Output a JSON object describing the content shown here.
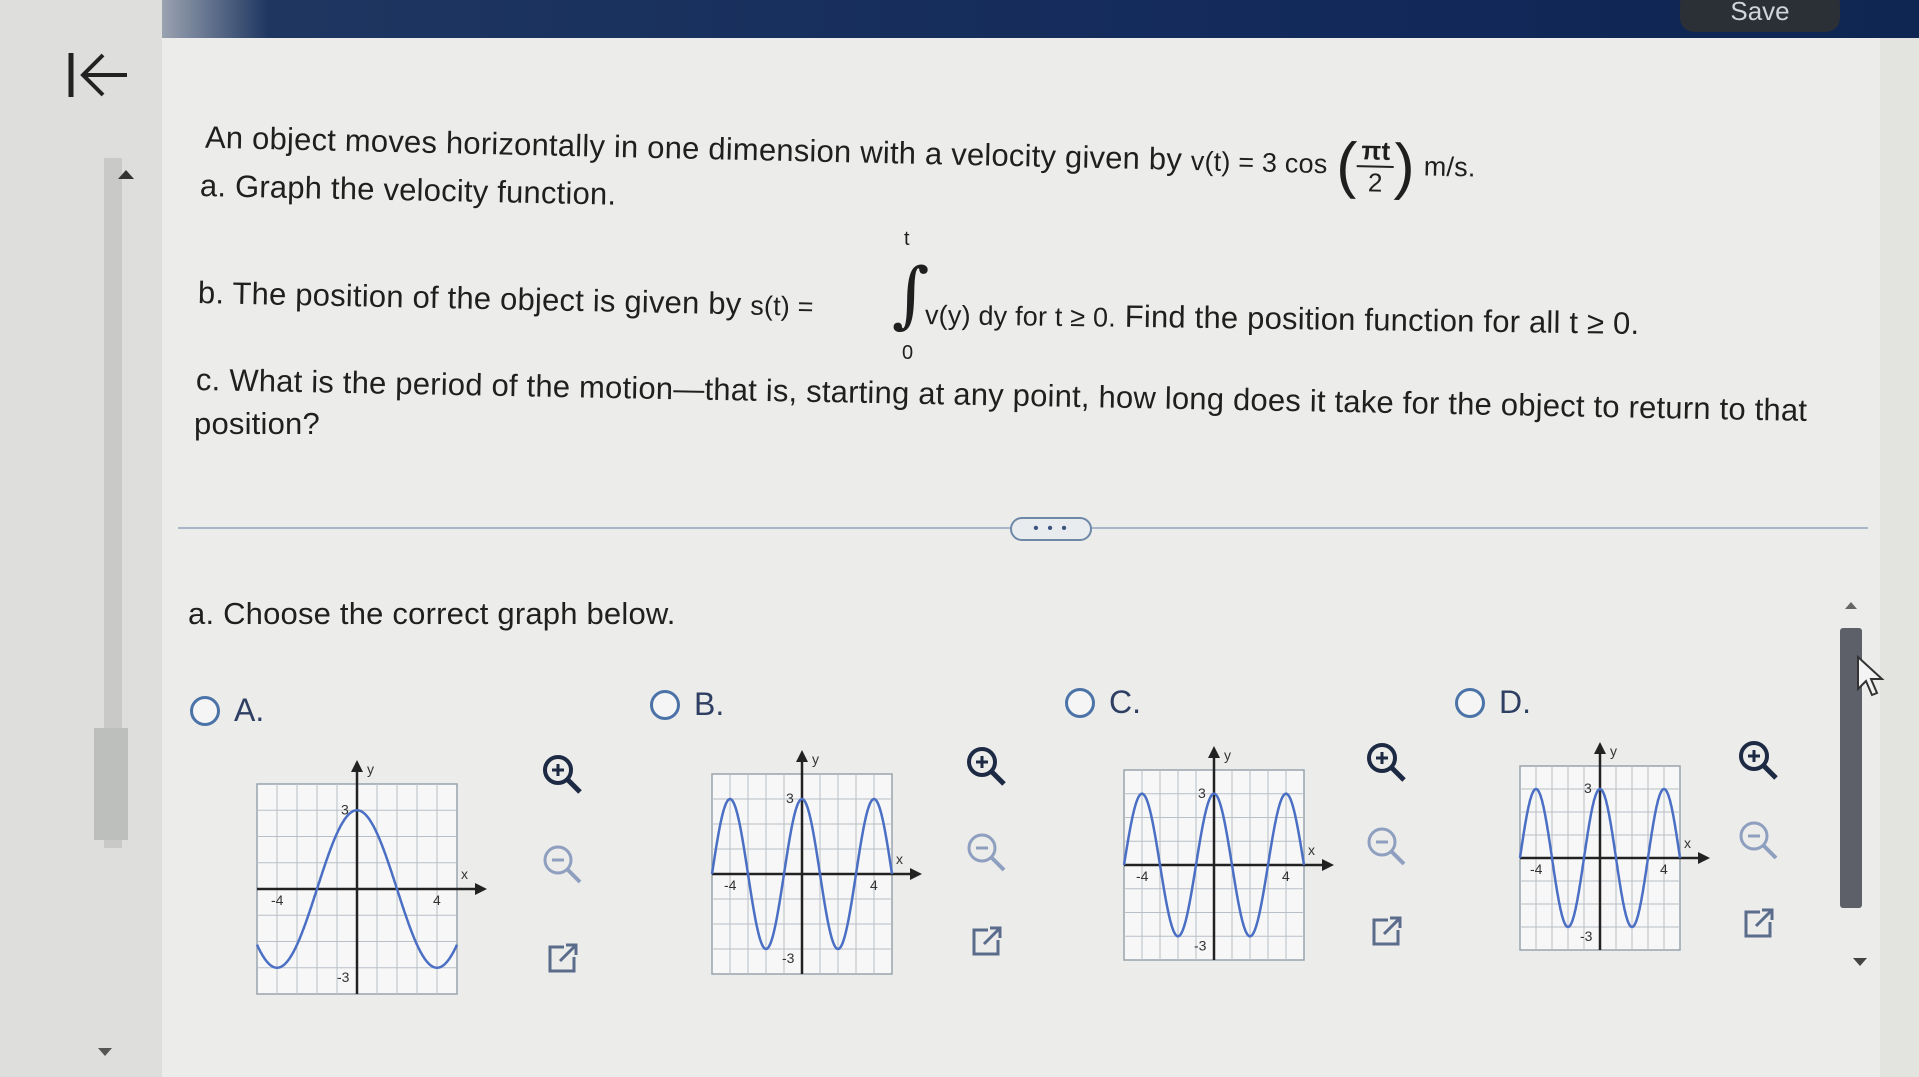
{
  "toolbar": {
    "save_label": "Save"
  },
  "question": {
    "intro_before": "An object moves horizontally in one dimension with a velocity given by",
    "velocity_lhs": "v(t) = 3 cos",
    "velocity_num": "πt",
    "velocity_den": "2",
    "velocity_units": "m/s.",
    "part_a": "a. Graph the velocity function.",
    "part_b_before": "b. The position of the object is given by",
    "integral_lhs": "s(t) =",
    "integral_upper": "t",
    "integral_lower": "0",
    "integral_body": "v(y) dy for t ≥ 0.",
    "part_b_after": "Find the position function for all t ≥ 0.",
    "part_c_line1": "c. What is the period of the motion—that is, starting at any point, how long does it take for the object to return to that",
    "part_c_line2": "position?"
  },
  "divider_label": "• • •",
  "answer": {
    "prompt": "a. Choose the correct graph below.",
    "options": [
      {
        "label": "A.",
        "ytop": "3",
        "ybot": "-3",
        "xl": "-4",
        "xr": "4",
        "yaxis": "y",
        "xaxis": "x"
      },
      {
        "label": "B.",
        "ytop": "3",
        "ybot": "-3",
        "xl": "-4",
        "xr": "4",
        "yaxis": "y",
        "xaxis": "x"
      },
      {
        "label": "C.",
        "ytop": "3",
        "ybot": "-3",
        "xl": "-4",
        "xr": "4",
        "yaxis": "y",
        "xaxis": "x"
      },
      {
        "label": "D.",
        "ytop": "3",
        "ybot": "-3",
        "xl": "-4",
        "xr": "4",
        "yaxis": "y",
        "xaxis": "x"
      }
    ]
  },
  "icons": {
    "back": "first-page-arrow-icon",
    "zoom_in": "zoom-in-icon",
    "zoom_out": "zoom-out-icon",
    "popout": "open-in-new-window-icon"
  },
  "colors": {
    "curve": "#4a6fc4",
    "radio": "#4b73a8",
    "header": "#12295a"
  }
}
